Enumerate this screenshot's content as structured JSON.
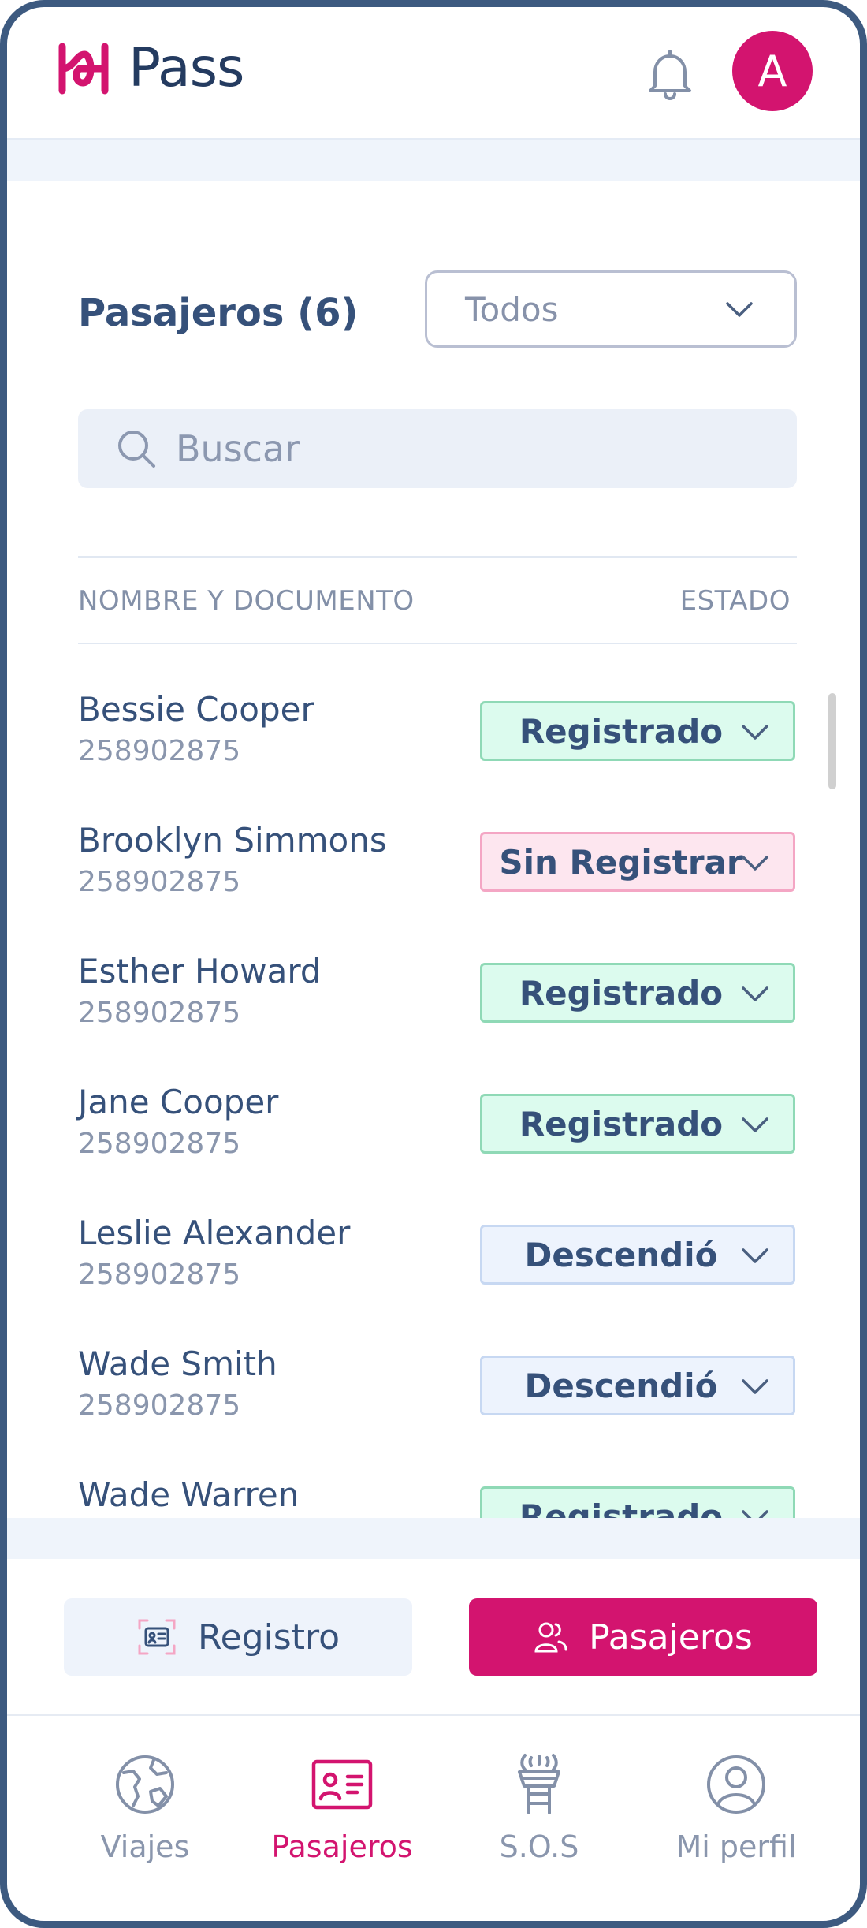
{
  "app": {
    "name": "Pass",
    "avatar_initial": "A"
  },
  "colors": {
    "brand": "#d3146f",
    "text": "#36517a",
    "registered": "#dcfbee",
    "unregistered": "#fde6ef",
    "descended": "#edf3fd"
  },
  "passengers": {
    "title": "Pasajeros (6)",
    "filter_value": "Todos",
    "search_placeholder": "Buscar",
    "col_name": "NOMBRE Y DOCUMENTO",
    "col_status": "ESTADO",
    "rows": [
      {
        "name": "Bessie Cooper",
        "doc": "258902875",
        "status": "Registrado",
        "status_key": "registrado"
      },
      {
        "name": "Brooklyn Simmons",
        "doc": "258902875",
        "status": "Sin Registrar",
        "status_key": "sin"
      },
      {
        "name": "Esther Howard",
        "doc": "258902875",
        "status": "Registrado",
        "status_key": "registrado"
      },
      {
        "name": "Jane Cooper",
        "doc": "258902875",
        "status": "Registrado",
        "status_key": "registrado"
      },
      {
        "name": "Leslie Alexander",
        "doc": "258902875",
        "status": "Descendió",
        "status_key": "descendio"
      },
      {
        "name": "Wade Smith",
        "doc": "258902875",
        "status": "Descendió",
        "status_key": "descendio"
      },
      {
        "name": "Wade Warren",
        "doc": "",
        "status": "Registrado",
        "status_key": "registrado"
      }
    ]
  },
  "actions": {
    "registro": "Registro",
    "pasajeros": "Pasajeros"
  },
  "nav": [
    {
      "label": "Viajes",
      "icon": "globe-icon",
      "active": false
    },
    {
      "label": "Pasajeros",
      "icon": "id-card-icon",
      "active": true
    },
    {
      "label": "S.O.S",
      "icon": "control-tower-icon",
      "active": false
    },
    {
      "label": "Mi perfil",
      "icon": "user-circle-icon",
      "active": false
    }
  ]
}
